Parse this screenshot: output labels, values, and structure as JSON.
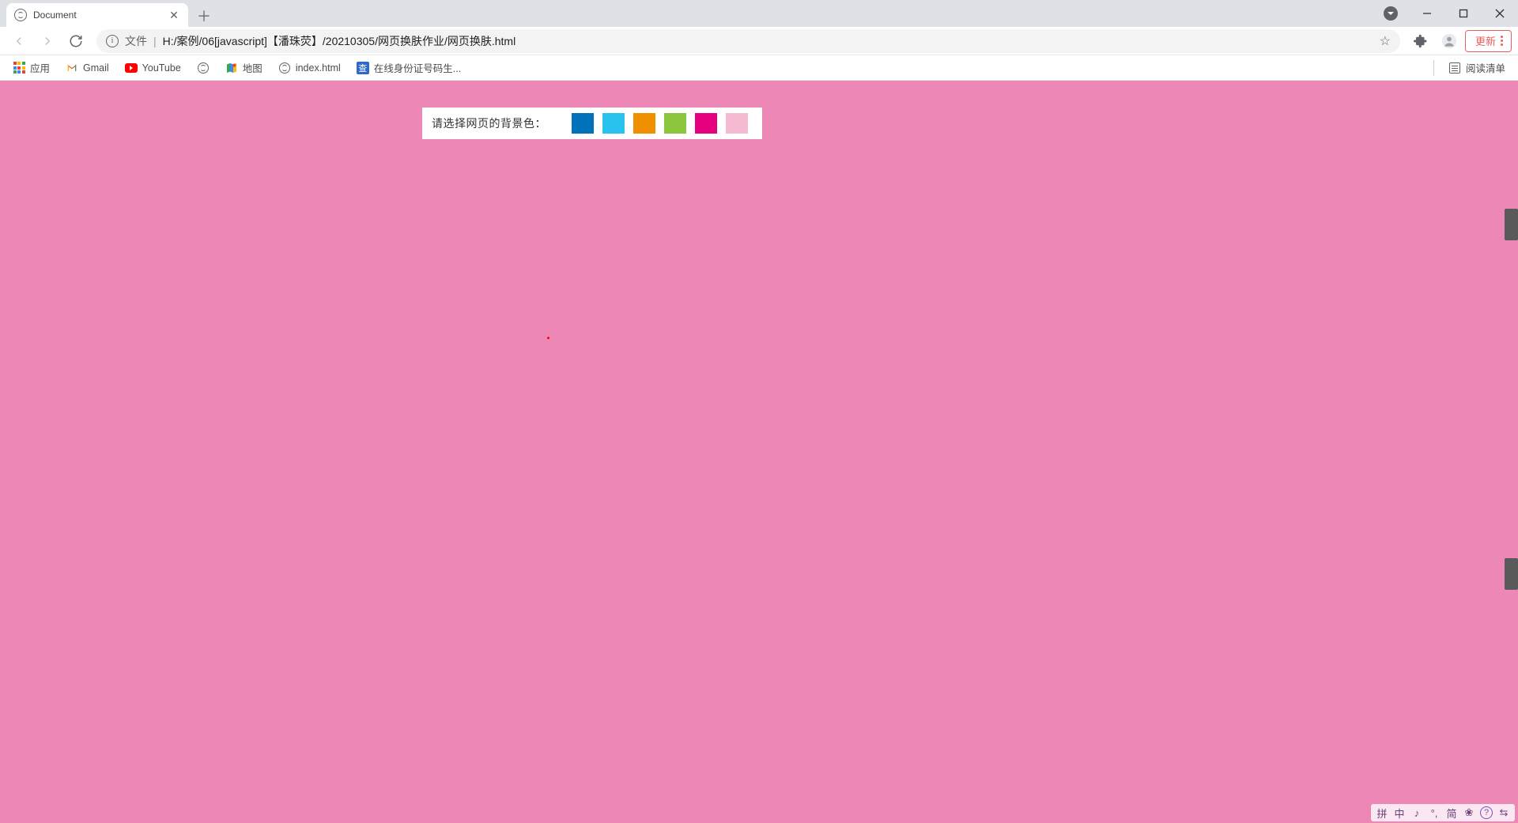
{
  "tab": {
    "title": "Document"
  },
  "omnibox": {
    "scheme": "文件",
    "path": "H:/案例/06[javascript]【潘珠荧】/20210305/网页换肤作业/网页换肤.html"
  },
  "update_button_label": "更新",
  "bookmarks": {
    "apps": "应用",
    "gmail": "Gmail",
    "youtube": "YouTube",
    "maps": "地图",
    "index": "index.html",
    "idgen": "在线身份证号码生...",
    "reading_list": "阅读清单"
  },
  "page": {
    "label": "请选择网页的背景色：",
    "background_color": "#ec87b6",
    "swatches": [
      {
        "name": "blue",
        "color": "#0072bc"
      },
      {
        "name": "sky",
        "color": "#29c2ee"
      },
      {
        "name": "orange",
        "color": "#f09000"
      },
      {
        "name": "green",
        "color": "#8cc63f"
      },
      {
        "name": "magenta",
        "color": "#e5007f"
      },
      {
        "name": "lightpink",
        "color": "#f7bad3"
      }
    ]
  },
  "ime": {
    "items": [
      "拼",
      "中",
      "♪",
      "°,",
      "简",
      "❀"
    ]
  }
}
